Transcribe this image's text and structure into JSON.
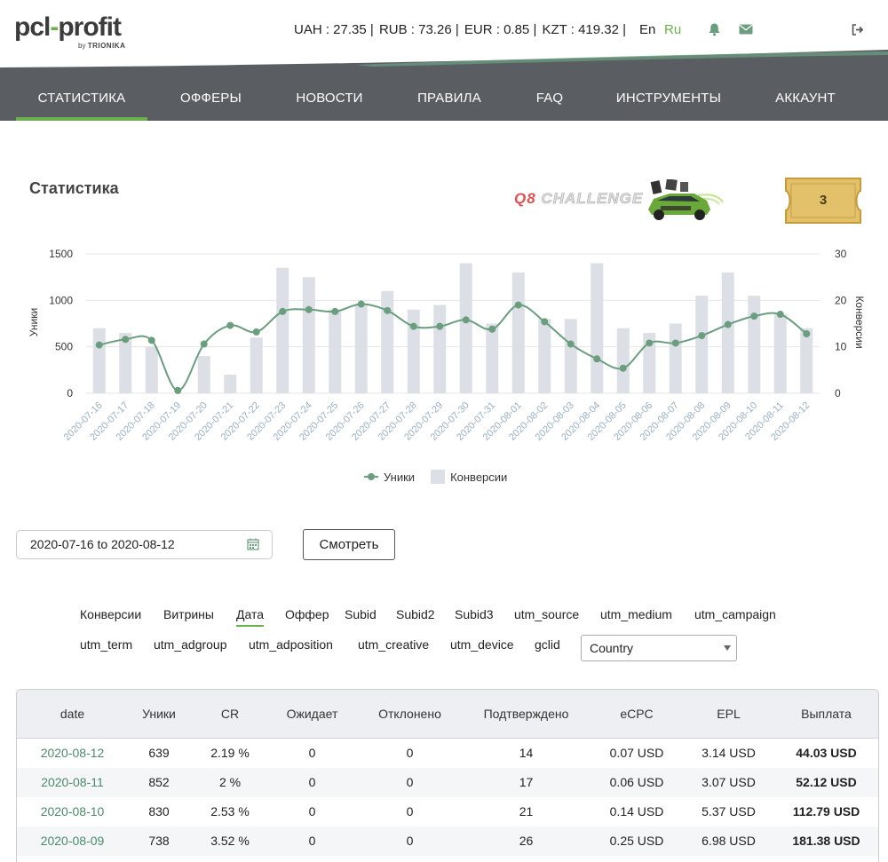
{
  "header": {
    "logo": {
      "main_a": "pcl",
      "main_dash": "-",
      "main_b": "profit",
      "sub_by": "by",
      "sub_brand": "TRIONIKA"
    },
    "rates": [
      "UAH : 27.35 |",
      "RUB : 73.26 |",
      "EUR : 0.85 |",
      "KZT : 419.32 |"
    ],
    "lang_en": "En",
    "lang_ru": "Ru",
    "icons": {
      "bell": "🔔",
      "mail": "✉",
      "logout": "⇥"
    }
  },
  "nav": {
    "items": [
      "СТАТИСТИКА",
      "ОФФЕРЫ",
      "НОВОСТИ",
      "ПРАВИЛА",
      "FAQ",
      "ИНСТРУМЕНТЫ",
      "АККАУНТ"
    ],
    "active_index": 0
  },
  "page": {
    "title": "Статистика",
    "promo_text_q": "Q8",
    "promo_text_rest": " CHALLENGE",
    "ticket_count": "3"
  },
  "chart_data": {
    "type": "bar+line",
    "categories": [
      "2020-07-16",
      "2020-07-17",
      "2020-07-18",
      "2020-07-19",
      "2020-07-20",
      "2020-07-21",
      "2020-07-22",
      "2020-07-23",
      "2020-07-24",
      "2020-07-25",
      "2020-07-26",
      "2020-07-27",
      "2020-07-28",
      "2020-07-29",
      "2020-07-30",
      "2020-07-31",
      "2020-08-01",
      "2020-08-02",
      "2020-08-03",
      "2020-08-04",
      "2020-08-05",
      "2020-08-06",
      "2020-08-07",
      "2020-08-08",
      "2020-08-09",
      "2020-08-10",
      "2020-08-11",
      "2020-08-12"
    ],
    "series": [
      {
        "name": "Уники",
        "kind": "line",
        "axis": "left",
        "values": [
          520,
          580,
          570,
          30,
          530,
          730,
          660,
          880,
          900,
          880,
          960,
          890,
          720,
          720,
          790,
          690,
          950,
          770,
          530,
          370,
          270,
          540,
          540,
          620,
          740,
          830,
          850,
          640
        ]
      },
      {
        "name": "Конверсии",
        "kind": "bar",
        "axis": "right",
        "values": [
          14,
          13,
          10,
          0,
          8,
          4,
          12,
          27,
          25,
          18,
          19,
          22,
          18,
          19,
          28,
          15,
          26,
          16,
          16,
          28,
          14,
          13,
          15,
          21,
          26,
          21,
          17,
          14
        ]
      }
    ],
    "ylabel_left": "Уники",
    "ylabel_right": "Конверсии",
    "yticks_left": [
      "0",
      "500",
      "1000",
      "1500"
    ],
    "yticks_right": [
      "0",
      "10",
      "20",
      "30"
    ],
    "ylim_left": [
      0,
      1500
    ],
    "ylim_right": [
      0,
      30
    ],
    "legend_position": "bottom-center",
    "colors": {
      "line": "#6a9e7f",
      "bar": "#dcdfe5"
    }
  },
  "filters": {
    "date_range": "2020-07-16 to 2020-08-12",
    "view_button": "Смотреть",
    "tabs_row1": [
      "Конверсии",
      "Витрины",
      "Дата",
      "Оффер",
      "Subid",
      "Subid2",
      "Subid3",
      "utm_source",
      "utm_medium",
      "utm_campaign"
    ],
    "tabs_row2": [
      "utm_term",
      "utm_adgroup",
      "utm_adposition",
      "utm_creative",
      "utm_device",
      "gclid"
    ],
    "active_tab": "Дата",
    "country_select": "Country"
  },
  "table": {
    "columns": [
      "date",
      "Уники",
      "CR",
      "Ожидает",
      "Отклонено",
      "Подтверждено",
      "eCPC",
      "EPL",
      "Выплата"
    ],
    "rows": [
      [
        "2020-08-12",
        "639",
        "2.19 %",
        "0",
        "0",
        "14",
        "0.07 USD",
        "3.14 USD",
        "44.03 USD"
      ],
      [
        "2020-08-11",
        "852",
        "2 %",
        "0",
        "0",
        "17",
        "0.06 USD",
        "3.07 USD",
        "52.12 USD"
      ],
      [
        "2020-08-10",
        "830",
        "2.53 %",
        "0",
        "0",
        "21",
        "0.14 USD",
        "5.37 USD",
        "112.79 USD"
      ],
      [
        "2020-08-09",
        "738",
        "3.52 %",
        "0",
        "0",
        "26",
        "0.25 USD",
        "6.98 USD",
        "181.38 USD"
      ]
    ]
  }
}
